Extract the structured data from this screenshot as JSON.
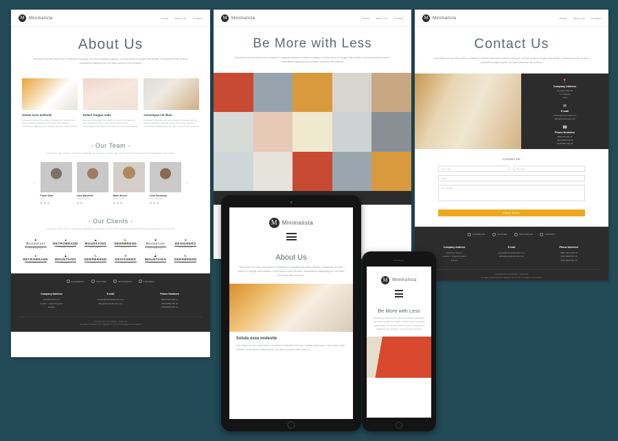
{
  "background_color": "#234a57",
  "brand": {
    "mark": "M",
    "name": "Minimalista"
  },
  "nav": {
    "home": "Home",
    "about": "About Us",
    "contact": "Contact"
  },
  "lorem": {
    "hero": "Duis autem vel eum iriure dolor in hendrerit in vulputate velit esse molestie consequat, vel illum dolore eu feugiat nulla facilisis. Lorem ipsum dolor sit amet, consectetuer adipiscing elit, sed diam nonummy nibh euismod.",
    "short": "Duis autem vel eum iriure dolor in hendrerit in vulputate velit esse molestie consequat. Lorem ipsum dolor sit amet, consectetuer adipiscing elit, sed diam nonummy nibh euismod.",
    "section": "Lorem ipsum dolor sit amet, consectetuer adipiscing elit, sed diam nonummy nibh euismod tincidunt ut laoreet dolore magna aliquam erat volutpat."
  },
  "about_page": {
    "title": "About Us",
    "cards": [
      {
        "title": "Soluta esse molestie",
        "text": "Duis autem vel eum iriure dolor in hendrerit in vulputate velit esse molestie consequat. Lorem ipsum dolor sit amet, consectetuer adipiscing elit, sed diam nonummy nibh euismod."
      },
      {
        "title": "Dolore feugiat nulla",
        "text": "Duis dolor in hendrerit cum autem vel eum in vulputate velit esse molestie vel illum. Lorem ipsum dolor sit amet, consectetuer adipiscing elit, sed diam nonummy nibh euismod."
      },
      {
        "title": "Consequat vel illum",
        "text": "Hendrerit in vulputate velit esse molestie consequat, vel illum dolore eu feugiat consequat. Lorem ipsum dolor sit amet, consectetuer adipiscing elit, sed diam nonummy nibh euismod."
      }
    ],
    "team_heading": "- Our Team -",
    "team": [
      {
        "name": "Frank Starr",
        "role": "CEO"
      },
      {
        "name": "Jane Naismith",
        "role": "Graphic Designer"
      },
      {
        "name": "Mark Stoner",
        "role": "Web Developer"
      },
      {
        "name": "John Sandman",
        "role": "Account Manager"
      }
    ],
    "prev_arrow": "‹",
    "next_arrow": "›",
    "clients_heading": "- Our Clients -",
    "clients": [
      {
        "glyph": "♜",
        "name": "Restaurant",
        "sub": "EST. SINCE 1984",
        "script": true
      },
      {
        "glyph": "★",
        "name": "RETROBRAND",
        "sub": "ORIGINAL GOODS",
        "script": false
      },
      {
        "glyph": "⛰",
        "name": "MOUNTAINS",
        "sub": "HIGH QUALITY",
        "script": false
      },
      {
        "glyph": "🐎",
        "name": "DEERBREND",
        "sub": "SINCE 1921",
        "script": false
      },
      {
        "glyph": "♜",
        "name": "Restaurant",
        "sub": "EST. SINCE 1984",
        "script": true
      },
      {
        "glyph": "⚙",
        "name": "DESIGNERS",
        "sub": "CREATIVE WORK",
        "script": false
      },
      {
        "glyph": "★",
        "name": "RETROBRAND",
        "sub": "ORIGINAL GOODS",
        "script": false
      },
      {
        "glyph": "⛰",
        "name": "MOUNTAINS",
        "sub": "HIGH QUALITY",
        "script": false
      },
      {
        "glyph": "🐎",
        "name": "DEERBREND",
        "sub": "SINCE 1921",
        "script": false
      },
      {
        "glyph": "⚙",
        "name": "DESIGNERS",
        "sub": "CREATIVE WORK",
        "script": false
      },
      {
        "glyph": "⛰",
        "name": "MOUNTAINS",
        "sub": "HIGH QUALITY",
        "script": false
      },
      {
        "glyph": "🐎",
        "name": "DEERBREND",
        "sub": "SINCE 1921",
        "script": false
      }
    ]
  },
  "gallery_page": {
    "title": "Be More with Less",
    "tiles": [
      "#c94a32",
      "#98a4ad",
      "#d99a3e",
      "#d8d5cf",
      "#c8a882",
      "#d8dad8",
      "#e8c9b8",
      "#efe9cf",
      "#cfd2d2",
      "#8a8f95",
      "#cfd6da",
      "#e6e3da",
      "#c94a32",
      "#9aa6ae",
      "#d99a3e"
    ]
  },
  "contact_page": {
    "title": "Contact Us",
    "info": [
      {
        "icon": "📍",
        "icon_name": "location-pin-icon",
        "title": "Company Address",
        "lines": "Sunshine Way 98\nLos Angeles\nUSA"
      },
      {
        "icon": "✉",
        "icon_name": "envelope-icon",
        "title": "E-mail",
        "lines": "contact@yourdomain.com\noffice@yourdomain.com"
      },
      {
        "icon": "☎",
        "icon_name": "headset-icon",
        "title": "Phone Numbers",
        "lines": "0800 920 908 12\n0300 9899 530 18\n0798 8090 960 15"
      }
    ],
    "form": {
      "heading": "Contact Us",
      "name_placeholder": "Your e-mail",
      "email_placeholder": "Your name",
      "subject_placeholder": "Subject",
      "message_placeholder": "Your message",
      "submit_label": "Submit Button"
    }
  },
  "footer": {
    "social": [
      {
        "icon": "f",
        "label": "FACEBOOK"
      },
      {
        "icon": "t",
        "label": "TWITTER"
      },
      {
        "icon": "▢",
        "label": "INSTAGRAM"
      },
      {
        "icon": "in",
        "label": "LINKEDIN"
      }
    ],
    "columns": [
      {
        "title": "Company Address",
        "lines": "Sunshine Street 7\nLondon - United Kingdom\nEurope"
      },
      {
        "title": "E-mail",
        "lines": "contact@sampledomain.com\noffice@sampledomain.com"
      },
      {
        "title": "Phone Numbers",
        "lines": "0800 4321 908 12\n0450 9899 530 18\n0789 8090 960 15"
      }
    ],
    "legal_1": "Copyright 2017, Here Design - graphic.site",
    "legal_2": "All images is purchased from Bigstock. Do not use the images in your website."
  },
  "tablet": {
    "title": "About Us",
    "section_title": "Soluta esse molestie"
  },
  "phone": {
    "title": "Be More with Less"
  }
}
